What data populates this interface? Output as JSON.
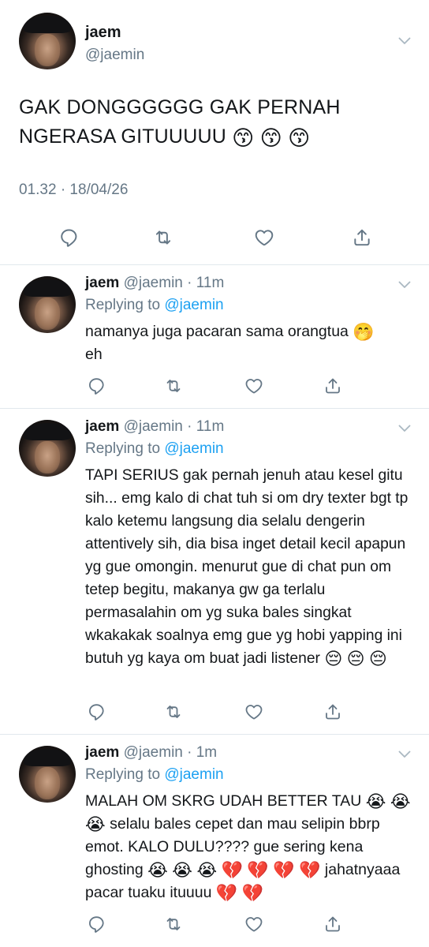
{
  "main_tweet": {
    "display_name": "jaem",
    "handle": "@jaemin",
    "text": "GAK DONGGGGGG GAK PERNAH NGERASA GITUUUUU",
    "emojis": [
      "😙",
      "😙",
      "😙"
    ],
    "timestamp": "01.32 · 18/04/26"
  },
  "replies": [
    {
      "display_name": "jaem",
      "meta": "@jaemin · 11m",
      "replying_prefix": "Replying to",
      "replying_handle": "@jaemin",
      "text": "namanya juga pacaran sama orangtua",
      "emoji_inline": "🤭",
      "text_tail": "eh"
    },
    {
      "display_name": "jaem",
      "meta": "@jaemin · 11m",
      "replying_prefix": "Replying to",
      "replying_handle": "@jaemin",
      "text": "TAPI SERIUS gak pernah jenuh atau kesel gitu sih... emg kalo di chat tuh si om dry texter bgt tp kalo ketemu langsung dia selalu dengerin attentively sih, dia bisa inget detail kecil apapun yg gue omongin. menurut gue di chat pun om tetep begitu, makanya gw ga terlalu permasalahin om yg suka bales singkat wkakakak soalnya emg gue yg hobi yapping ini butuh yg kaya om buat jadi listener",
      "emojis": [
        "😔",
        "😔",
        "😔"
      ]
    },
    {
      "display_name": "jaem",
      "meta": "@jaemin · 1m",
      "replying_prefix": "Replying to",
      "replying_handle": "@jaemin",
      "text_a": "MALAH OM SKRG UDAH BETTER TAU",
      "emojis_a": [
        "😭",
        "😭",
        "😭"
      ],
      "text_b": "selalu bales cepet dan mau selipin bbrp emot. KALO DULU???? gue sering kena ghosting",
      "emojis_b": [
        "😭",
        "😭",
        "😭",
        "💔",
        "💔",
        "💔",
        "💔"
      ],
      "text_c": "jahatnyaaa pacar tuaku ituuuu",
      "emojis_c": [
        "💔",
        "💔"
      ]
    }
  ],
  "icons": [
    "reply-icon",
    "retweet-icon",
    "like-icon",
    "share-icon",
    "chevron-down-icon"
  ],
  "colors": {
    "link": "#1da1f2",
    "secondary_text": "#657786",
    "divider": "#e1e8ed",
    "icon": "#657786"
  }
}
